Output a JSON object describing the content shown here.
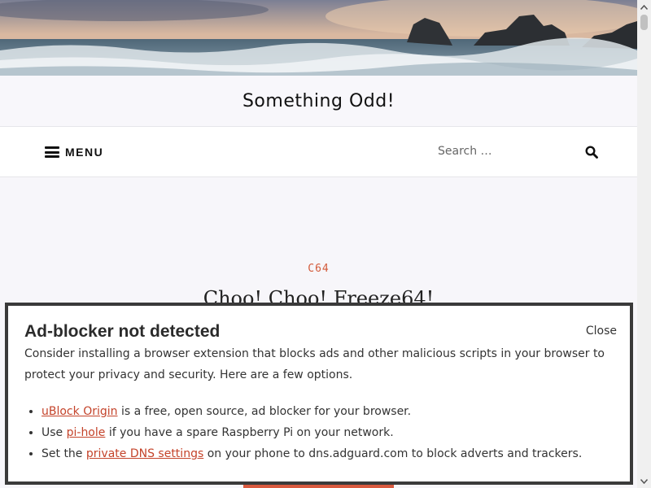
{
  "site": {
    "title": "Something Odd!"
  },
  "nav": {
    "menu_label": "MENU",
    "search_placeholder": "Search …"
  },
  "post": {
    "category": "C64",
    "title": "Choo! Choo! Freeze64!"
  },
  "modal": {
    "title": "Ad-blocker not detected",
    "close_label": "Close",
    "intro": "Consider installing a browser extension that blocks ads and other malicious scripts in your browser to protect your privacy and security. Here are a few options.",
    "items": [
      {
        "prefix": "",
        "link": "uBlock Origin",
        "suffix": " is a free, open source, ad blocker for your browser."
      },
      {
        "prefix": "Use ",
        "link": "pi-hole",
        "suffix": " if you have a spare Raspberry Pi on your network."
      },
      {
        "prefix": "Set the ",
        "link": "private DNS settings",
        "suffix": " on your phone to dns.adguard.com to block adverts and trackers."
      }
    ]
  },
  "colors": {
    "accent": "#d35a3a",
    "link": "#c4432a",
    "modal_border": "#3a3a3a"
  },
  "icons": {
    "menu": "hamburger-icon",
    "search": "magnifier-icon"
  }
}
